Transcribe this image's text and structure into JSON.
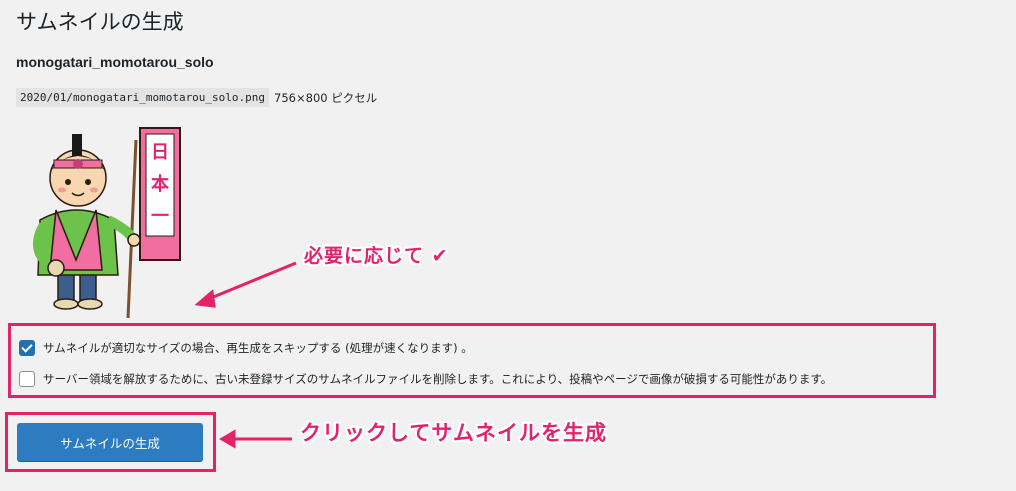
{
  "page": {
    "title": "サムネイルの生成"
  },
  "file": {
    "name": "monogatari_momotarou_solo",
    "path": "2020/01/monogatari_momotarou_solo.png",
    "dimensions": "756×800 ピクセル"
  },
  "preview": {
    "banner_text": "日本一"
  },
  "annotations": {
    "note_optional": "必要に応じて ✔",
    "note_click": "クリックしてサムネイルを生成",
    "accent_color": "#e4226a"
  },
  "options": [
    {
      "label": "サムネイルが適切なサイズの場合、再生成をスキップする (処理が速くなります) 。",
      "checked": true
    },
    {
      "label": "サーバー領域を解放するために、古い未登録サイズのサムネイルファイルを削除します。これにより、投稿やページで画像が破損する可能性があります。",
      "checked": false
    }
  ],
  "actions": {
    "generate_label": "サムネイルの生成",
    "button_color": "#2d7bc1"
  }
}
